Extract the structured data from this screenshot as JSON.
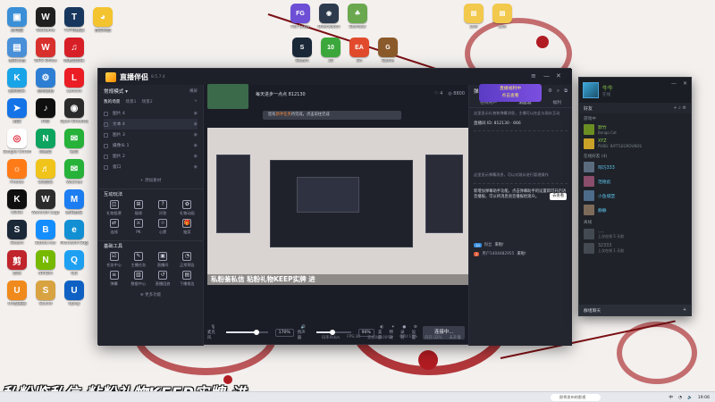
{
  "desktop": {
    "icons": [
      {
        "label": "此电脑",
        "color": "#3b8fd6",
        "glyph": "▣"
      },
      {
        "label": "WeGame",
        "color": "#1f1f1f",
        "glyph": "W"
      },
      {
        "label": "TXT转换器",
        "color": "#17375e",
        "glyph": "T"
      },
      {
        "label": "百度网盘",
        "color": "#f4c430",
        "glyph": "◕"
      },
      {
        "label": "我的文档",
        "color": "#4a90d9",
        "glyph": "▤"
      },
      {
        "label": "WPS Office",
        "color": "#d8302d",
        "glyph": "W"
      },
      {
        "label": "网易云音乐",
        "color": "#d71f27",
        "glyph": "♫"
      },
      {
        "label": "酷狗音乐",
        "color": "#1aa4e8",
        "glyph": "K"
      },
      {
        "label": "控制面板",
        "color": "#2e7fd3",
        "glyph": "⚙"
      },
      {
        "label": "Lenovo",
        "color": "#eb1e25",
        "glyph": "L"
      },
      {
        "label": "迅雷",
        "color": "#1473e6",
        "glyph": "➤"
      },
      {
        "label": "抖音",
        "color": "#0f0f0f",
        "glyph": "♪"
      },
      {
        "label": "Open Broadcaster",
        "color": "#2b2b2b",
        "glyph": "◉"
      },
      {
        "label": "Google Chrome",
        "color": "#ffffff",
        "glyph": "◎"
      },
      {
        "label": "网易云",
        "color": "#0ca45f",
        "glyph": "N"
      },
      {
        "label": "微信",
        "color": "#27b23a",
        "glyph": "✉"
      },
      {
        "label": "Firefox",
        "color": "#ff7b17",
        "glyph": "☼"
      },
      {
        "label": "QQ音乐",
        "color": "#f0c41b",
        "glyph": "♬"
      },
      {
        "label": "WeChat",
        "color": "#27b23a",
        "glyph": "✉"
      },
      {
        "label": "KOOK",
        "color": "#0f0f0f",
        "glyph": "K"
      },
      {
        "label": "Warcraft Logs",
        "color": "#2c2c2c",
        "glyph": "W"
      },
      {
        "label": "腾讯会议",
        "color": "#1d7ef2",
        "glyph": "M"
      },
      {
        "label": "Steam",
        "color": "#1b2838",
        "glyph": "S"
      },
      {
        "label": "Battle.net",
        "color": "#148eff",
        "glyph": "B"
      },
      {
        "label": "Microsoft Edge",
        "color": "#1390d4",
        "glyph": "e"
      },
      {
        "label": "剪映",
        "color": "#c0242c",
        "glyph": "剪"
      },
      {
        "label": "NVIDIA",
        "color": "#76b900",
        "glyph": "N"
      },
      {
        "label": "QQ",
        "color": "#1ea1f3",
        "glyph": "Q"
      },
      {
        "label": "UU加速器",
        "color": "#f08a1c",
        "glyph": "U"
      },
      {
        "label": "Sound",
        "color": "#d9a342",
        "glyph": "S"
      },
      {
        "label": "Uplay",
        "color": "#0f62c4",
        "glyph": "U"
      }
    ],
    "top_icons": [
      {
        "label": "Fall Guys",
        "color": "#6d4fd6",
        "glyph": "FG"
      },
      {
        "label": "Overwatch",
        "color": "#2e3b4e",
        "glyph": "◉"
      },
      {
        "label": "Stardew",
        "color": "#6aa84f",
        "glyph": "☘"
      },
      {
        "label": "Steam",
        "color": "#1b2838",
        "glyph": "S"
      },
      {
        "label": "10",
        "color": "#3ca83c",
        "glyph": "10"
      },
      {
        "label": "EA",
        "color": "#e14b2c",
        "glyph": "EA"
      },
      {
        "label": "Game",
        "color": "#8b5a2b",
        "glyph": "G"
      },
      {
        "label": "文件",
        "color": "#f2c94c",
        "glyph": "▤"
      },
      {
        "label": "文件",
        "color": "#f2c94c",
        "glyph": "▤"
      }
    ]
  },
  "app": {
    "name": "直播伴侣",
    "version": "8.5.7.4",
    "mode": "常规模式",
    "mode_right": "横屏",
    "scene_tabs": [
      "我的场景",
      "场景1",
      "场景2"
    ],
    "sources": [
      {
        "name": "图片 4",
        "selected": false
      },
      {
        "name": "文本 4",
        "selected": true
      },
      {
        "name": "图片 3",
        "selected": false
      },
      {
        "name": "摄像头 1",
        "selected": false
      },
      {
        "name": "图片 2",
        "selected": false
      },
      {
        "name": "窗口",
        "selected": false
      }
    ],
    "add_source": "+ 添加素材",
    "interact_title": "互动玩法",
    "interact_tools": [
      "礼物投票",
      "福袋",
      "问答",
      "礼物动画",
      "连线",
      "PK",
      "心愿",
      "抽奖"
    ],
    "basic_title": "基础工具",
    "basic_tools": [
      "任务中心",
      "主播任务",
      "直播间",
      "正常预告",
      "弹幕",
      "数据中心",
      "直播回放",
      "下播报告"
    ],
    "more": "更多功能",
    "stream_title": "每天进步一点点 812130",
    "notice_prefix": "您有",
    "notice_link": "新手任务",
    "notice_suffix": "待完成，点击前往完成",
    "stream_meta": [
      "开播指南",
      "开播前准备"
    ],
    "likes": "4",
    "viewers": "8800",
    "preview_banner": "私粉鉴私信 粘粉礼物KEEP实牌 进",
    "audio": {
      "mic_label": "麦克风",
      "mic_pct": "170%",
      "mic_level": 0.7,
      "speaker_label": "扬声器",
      "speaker_pct": "90%",
      "speaker_level": 0.45,
      "buttons": [
        "美颜",
        "特效",
        "录制",
        "设置"
      ],
      "start": "连接中..."
    },
    "status": [
      "码率0kb/s",
      "FPS:30",
      "丢帧0(0.00%)",
      "CPU:17%",
      "内存:32%",
      "未开播"
    ],
    "assistant": {
      "title": "弹幕助手",
      "tabs": [
        "在线用户",
        "消息流",
        "福利"
      ],
      "tip1": "这里显示礼物和弹幕消息，主播可以在此与观众互动",
      "room_line": "直播间 ID: 812130 · 666",
      "tip2": "这里显示弹幕消息，可以对观众进行管理操作",
      "tip3": "新增加弹幕助手功能，点击弹幕助手的设置即可开启语音播报，可以将消息语音播报给观众。",
      "go": "去查看",
      "chat": [
        {
          "user": "粉丝",
          "text": "来啦!"
        },
        {
          "user": "用户1404482955",
          "text": "来啦!"
        }
      ]
    },
    "ad": "直播福利中\n点击查看"
  },
  "steam": {
    "user": "牛牛",
    "user_status": "在线",
    "friends_label": "好友",
    "in_game_label": "游戏中",
    "in_game": [
      {
        "name": "默竹",
        "status": "Bongo Cat",
        "color": "#8fd14f"
      },
      {
        "name": "XYZ",
        "status": "PUBG: BATTLEGROUNDS",
        "color": "#8fd14f"
      }
    ],
    "online_label": "在线好友 (4)",
    "online": [
      {
        "name": "阿巧333",
        "color": "#5ec8f2"
      },
      {
        "name": "范德彪",
        "color": "#5ec8f2"
      },
      {
        "name": "小鱼城堡",
        "color": "#5ec8f2"
      },
      {
        "name": "静静",
        "color": "#5ec8f2"
      }
    ],
    "offline_label": "离线",
    "offline": [
      {
        "name": "、、、",
        "status": "上次在线 5 天前"
      },
      {
        "name": "32333",
        "status": "上次在线 1 天前"
      }
    ],
    "footer": "群组聊天"
  },
  "overlay_text": "私粉鉴私信  粘粉礼物KEEP实牌  进",
  "taskbar": {
    "search_placeholder": "即将发布的影视",
    "time": "19:06",
    "lang": "中"
  }
}
